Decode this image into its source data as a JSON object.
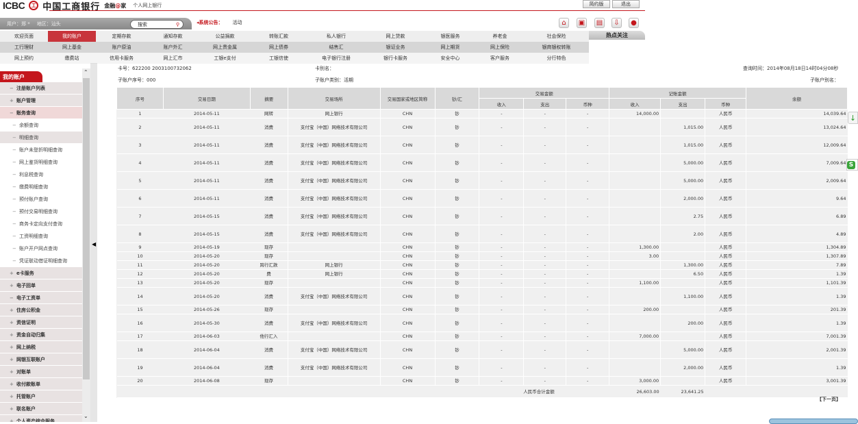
{
  "header": {
    "logo_en": "ICBC",
    "logo_seal": "工",
    "logo_cn": "中国工商银行",
    "slogan_a": "金融",
    "slogan_at": "@",
    "slogan_b": "家",
    "subtitle": "个人网上银行",
    "simple_btn": "简约版",
    "logout_btn": "退出"
  },
  "userbar": {
    "user_label": "用户：",
    "user": "郑 *",
    "region_label": "地区：",
    "region": "汕头",
    "search_placeholder": "搜索",
    "notice_label": "系统公告：",
    "notice_text": "活动"
  },
  "quick_icons": [
    "home-icon",
    "cart-icon",
    "contacts-icon",
    "download-icon",
    "service-icon"
  ],
  "nav": {
    "row1": [
      "欢迎页面",
      "我的账户",
      "定期存款",
      "通知存款",
      "公益捐款",
      "转账汇款",
      "私人银行",
      "网上贷款",
      "银医服务",
      "养老金",
      "社会保险"
    ],
    "row2": [
      "工行理财",
      "网上基金",
      "账户原油",
      "账户外汇",
      "网上贵金属",
      "网上债券",
      "结售汇",
      "银证业务",
      "网上期货",
      "网上保险",
      "银商银权转账"
    ],
    "row3": [
      "网上预约",
      "缴费站",
      "信用卡服务",
      "网上汇市",
      "工银e支付",
      "工银信使",
      "电子银行注册",
      "银行卡服务",
      "安全中心",
      "客户服务",
      "分行特色"
    ],
    "active": "我的账户",
    "hot": "热点关注"
  },
  "sidebar": {
    "title": "我的账户",
    "items": [
      {
        "label": "注册账户列表",
        "type": "group",
        "pm": "−"
      },
      {
        "label": "账户管理",
        "type": "group",
        "pm": "+"
      },
      {
        "label": "账务查询",
        "type": "group sel",
        "pm": "−"
      },
      {
        "label": "余额查询",
        "type": "sub",
        "pm": "−"
      },
      {
        "label": "明细查询",
        "type": "sub subsel",
        "pm": "−"
      },
      {
        "label": "账户未登折明细查询",
        "type": "sub",
        "pm": "−"
      },
      {
        "label": "网上鉴货明细查询",
        "type": "sub",
        "pm": "−"
      },
      {
        "label": "利息税查询",
        "type": "sub",
        "pm": "−"
      },
      {
        "label": "缴费明细查询",
        "type": "sub",
        "pm": "−"
      },
      {
        "label": "预付账户查询",
        "type": "sub",
        "pm": "−"
      },
      {
        "label": "预付交易明细查询",
        "type": "sub",
        "pm": "−"
      },
      {
        "label": "商务卡定向支付查询",
        "type": "sub",
        "pm": "−"
      },
      {
        "label": "工资明细查询",
        "type": "sub",
        "pm": "−"
      },
      {
        "label": "账户开户网点查询",
        "type": "sub",
        "pm": "−"
      },
      {
        "label": "凭证联动借证明细查询",
        "type": "sub",
        "pm": "−"
      },
      {
        "label": "e卡服务",
        "type": "group",
        "pm": "+"
      },
      {
        "label": "电子回单",
        "type": "group",
        "pm": "+"
      },
      {
        "label": "电子工资单",
        "type": "group",
        "pm": "−"
      },
      {
        "label": "住房公积金",
        "type": "group",
        "pm": "+"
      },
      {
        "label": "资信证明",
        "type": "group",
        "pm": "+"
      },
      {
        "label": "资金自动归集",
        "type": "group",
        "pm": "+"
      },
      {
        "label": "网上纳税",
        "type": "group",
        "pm": "+"
      },
      {
        "label": "网银互联账户",
        "type": "group",
        "pm": "+"
      },
      {
        "label": "对账单",
        "type": "group",
        "pm": "+"
      },
      {
        "label": "收付款账单",
        "type": "group",
        "pm": "+"
      },
      {
        "label": "托管账户",
        "type": "group",
        "pm": "+"
      },
      {
        "label": "联名账户",
        "type": "group",
        "pm": "+"
      },
      {
        "label": "个人资产综合服务",
        "type": "group",
        "pm": "+"
      }
    ]
  },
  "account": {
    "card_label": "卡号：",
    "card_no": "622200 2003100732062",
    "alias_label": "卡别名：",
    "alias": "",
    "sub_label": "子账户序号：",
    "sub_no": "000",
    "type_label": "子账户类别：",
    "type": "活期",
    "query_time_label": "查询时间：",
    "query_time": "2014年08月18日14时04分08秒",
    "sub_alias_label": "子账户别名：",
    "sub_alias": ""
  },
  "table": {
    "headers": {
      "no": "序号",
      "date": "交易日期",
      "summary": "摘要",
      "place": "交易场所",
      "country": "交易国家或地区简称",
      "cash": "钞/汇",
      "trade_amt": "交易金额",
      "book_amt": "记账金额",
      "income": "收入",
      "expense": "支出",
      "currency": "币种",
      "balance": "余额"
    },
    "rows": [
      [
        "1",
        "2014-05-11",
        "网转",
        "网上银行",
        "CHN",
        "钞",
        "-",
        "-",
        "-",
        "14,000.00",
        "",
        "人民币",
        "14,039.64"
      ],
      [
        "2",
        "2014-05-11",
        "消费",
        "支付宝（中国）网络技术有限公司",
        "CHN",
        "钞",
        "-",
        "-",
        "-",
        "",
        "1,015.00",
        "人民币",
        "13,024.64"
      ],
      [
        "3",
        "2014-05-11",
        "消费",
        "支付宝（中国）网络技术有限公司",
        "CHN",
        "钞",
        "-",
        "-",
        "-",
        "",
        "1,015.00",
        "人民币",
        "12,009.64"
      ],
      [
        "4",
        "2014-05-11",
        "消费",
        "支付宝（中国）网络技术有限公司",
        "CHN",
        "钞",
        "-",
        "-",
        "-",
        "",
        "5,000.00",
        "人民币",
        "7,009.64"
      ],
      [
        "5",
        "2014-05-11",
        "消费",
        "支付宝（中国）网络技术有限公司",
        "CHN",
        "钞",
        "-",
        "-",
        "-",
        "",
        "5,000.00",
        "人民币",
        "2,009.64"
      ],
      [
        "6",
        "2014-05-11",
        "消费",
        "支付宝（中国）网络技术有限公司",
        "CHN",
        "钞",
        "-",
        "-",
        "-",
        "",
        "2,000.00",
        "人民币",
        "9.64"
      ],
      [
        "7",
        "2014-05-15",
        "消费",
        "支付宝（中国）网络技术有限公司",
        "CHN",
        "钞",
        "-",
        "-",
        "-",
        "",
        "2.75",
        "人民币",
        "6.89"
      ],
      [
        "8",
        "2014-05-15",
        "消费",
        "支付宝（中国）网络技术有限公司",
        "CHN",
        "钞",
        "-",
        "-",
        "-",
        "",
        "2.00",
        "人民币",
        "4.89"
      ],
      [
        "9",
        "2014-05-19",
        "现存",
        "",
        "CHN",
        "钞",
        "-",
        "-",
        "-",
        "1,300.00",
        "",
        "人民币",
        "1,304.89"
      ],
      [
        "10",
        "2014-05-20",
        "现存",
        "",
        "CHN",
        "钞",
        "-",
        "-",
        "-",
        "3.00",
        "",
        "人民币",
        "1,307.89"
      ],
      [
        "11",
        "2014-05-20",
        "跨行汇款",
        "网上银行",
        "CHN",
        "钞",
        "-",
        "-",
        "-",
        "",
        "1,300.00",
        "人民币",
        "7.89"
      ],
      [
        "12",
        "2014-05-20",
        "费",
        "网上银行",
        "CHN",
        "钞",
        "-",
        "-",
        "-",
        "",
        "6.50",
        "人民币",
        "1.39"
      ],
      [
        "13",
        "2014-05-20",
        "现存",
        "",
        "CHN",
        "钞",
        "-",
        "-",
        "-",
        "1,100.00",
        "",
        "人民币",
        "1,101.39"
      ],
      [
        "14",
        "2014-05-20",
        "消费",
        "支付宝（中国）网络技术有限公司",
        "CHN",
        "钞",
        "-",
        "-",
        "-",
        "",
        "1,100.00",
        "人民币",
        "1.39"
      ],
      [
        "15",
        "2014-05-26",
        "现存",
        "",
        "CHN",
        "钞",
        "-",
        "-",
        "-",
        "200.00",
        "",
        "人民币",
        "201.39"
      ],
      [
        "16",
        "2014-05-30",
        "消费",
        "支付宝（中国）网络技术有限公司",
        "CHN",
        "钞",
        "-",
        "-",
        "-",
        "",
        "200.00",
        "人民币",
        "1.39"
      ],
      [
        "17",
        "2014-06-03",
        "他行汇入",
        "",
        "CHN",
        "钞",
        "-",
        "-",
        "-",
        "7,000.00",
        "",
        "人民币",
        "7,001.39"
      ],
      [
        "18",
        "2014-06-04",
        "消费",
        "支付宝（中国）网络技术有限公司",
        "CHN",
        "钞",
        "-",
        "-",
        "-",
        "",
        "5,000.00",
        "人民币",
        "2,001.39"
      ],
      [
        "19",
        "2014-06-04",
        "消费",
        "支付宝（中国）网络技术有限公司",
        "CHN",
        "钞",
        "-",
        "-",
        "-",
        "",
        "2,000.00",
        "人民币",
        "1.39"
      ],
      [
        "20",
        "2014-06-08",
        "现存",
        "",
        "CHN",
        "钞",
        "-",
        "-",
        "-",
        "3,000.00",
        "",
        "人民币",
        "3,001.39"
      ]
    ],
    "total_label": "人民币合计金额",
    "total_income": "26,603.00",
    "total_expense": "23,641.25"
  },
  "pager": {
    "next": "【下一页】"
  }
}
